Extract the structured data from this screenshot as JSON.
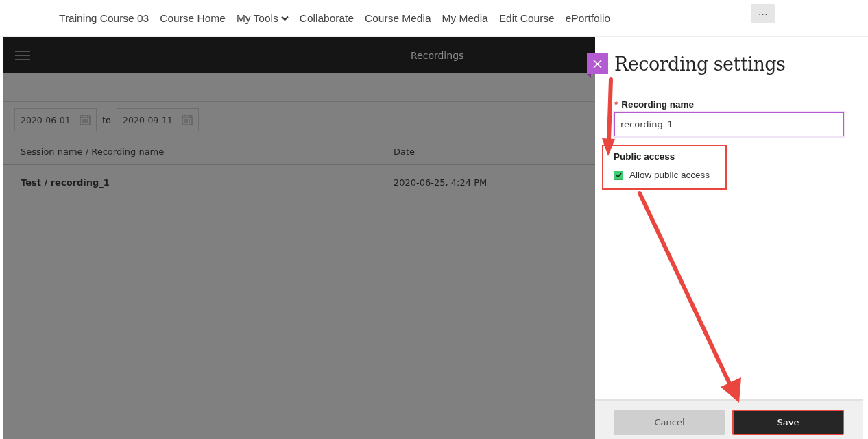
{
  "top_nav": {
    "items": [
      {
        "label": "Training Course 03",
        "dropdown": false
      },
      {
        "label": "Course Home",
        "dropdown": false
      },
      {
        "label": "My Tools",
        "dropdown": true
      },
      {
        "label": "Collaborate",
        "dropdown": false
      },
      {
        "label": "Course Media",
        "dropdown": false
      },
      {
        "label": "My Media",
        "dropdown": false
      },
      {
        "label": "Edit Course",
        "dropdown": false
      },
      {
        "label": "ePortfolio",
        "dropdown": false
      }
    ],
    "more_button": "···"
  },
  "recordings": {
    "title": "Recordings",
    "date_from": "2020-06-01",
    "date_to_label": "to",
    "date_to": "2020-09-11",
    "columns": [
      "Session name / Recording name",
      "Date"
    ],
    "rows": [
      {
        "name": "Test / recording_1",
        "date": "2020-06-25, 4:24 PM"
      }
    ]
  },
  "settings_panel": {
    "title": "Recording settings",
    "name_label": "Recording name",
    "required_mark": "*",
    "name_value": "recording_1",
    "public_access": {
      "heading": "Public access",
      "label": "Allow public access",
      "checked": true,
      "highlighted": true
    },
    "buttons": [
      {
        "label": "Cancel",
        "kind": "secondary",
        "highlighted": false
      },
      {
        "label": "Save",
        "kind": "primary",
        "highlighted": true
      }
    ]
  }
}
